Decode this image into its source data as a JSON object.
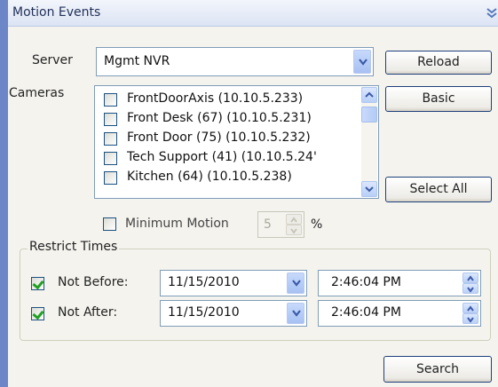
{
  "header": {
    "title": "Motion Events"
  },
  "server": {
    "label": "Server",
    "selected": "Mgmt NVR"
  },
  "buttons": {
    "reload": "Reload",
    "basic": "Basic",
    "select_all": "Select All",
    "search": "Search"
  },
  "cameras": {
    "label": "Cameras",
    "items": [
      {
        "label": "FrontDoorAxis (10.10.5.233)",
        "checked": false
      },
      {
        "label": "Front Desk (67) (10.10.5.231)",
        "checked": false
      },
      {
        "label": "Front Door (75) (10.10.5.232)",
        "checked": false
      },
      {
        "label": "Tech Support (41) (10.10.5.24'",
        "checked": false
      },
      {
        "label": "Kitchen (64) (10.10.5.238)",
        "checked": false
      }
    ]
  },
  "minimum_motion": {
    "label": "Minimum Motion",
    "value": "5",
    "unit": "%",
    "checked": false,
    "enabled": false
  },
  "restrict_times": {
    "title": "Restrict Times",
    "not_before": {
      "label": "Not Before:",
      "checked": true,
      "date": "11/15/2010",
      "time": "2:46:04 PM"
    },
    "not_after": {
      "label": "Not After:",
      "checked": true,
      "date": "11/15/2010",
      "time": "2:46:04 PM"
    }
  },
  "icons": {
    "header_chevron": "double-chevron-down-icon",
    "dropdown": "chevron-down-icon",
    "spinner": "spinner-arrows-icon"
  },
  "colors": {
    "accent": "#6c86c8",
    "panel_bg": "#f4f3ee",
    "check": "#21a121"
  }
}
